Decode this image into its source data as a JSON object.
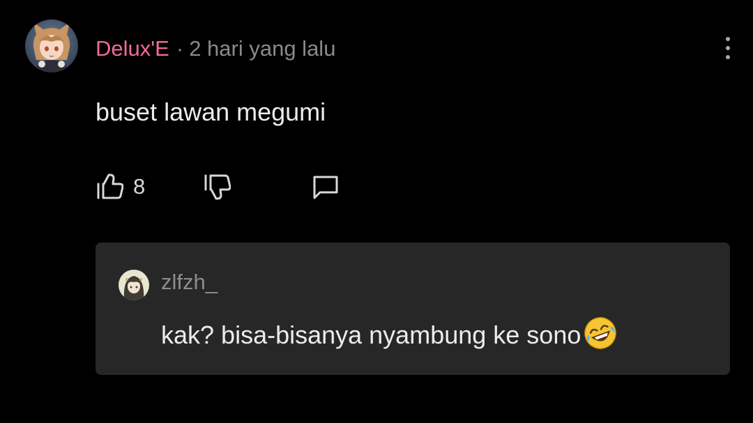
{
  "comment": {
    "username": "Delux'E",
    "separator": "·",
    "time": "2 hari yang lalu",
    "text": "buset lawan megumi",
    "likes": "8",
    "username_color": "#f06b9b"
  },
  "reply": {
    "username": "zlfzh_",
    "text": "kak? bisa-bisanya nyambung ke sono",
    "emoji": "rolling-on-floor-laughing"
  },
  "icons": {
    "like": "thumbs-up-icon",
    "dislike": "thumbs-down-icon",
    "reply": "reply-bubble-icon",
    "menu": "more-vertical-icon"
  },
  "colors": {
    "background": "#000000",
    "card": "#272727",
    "meta_text": "#8a8a8a",
    "body_text": "#ececec"
  }
}
